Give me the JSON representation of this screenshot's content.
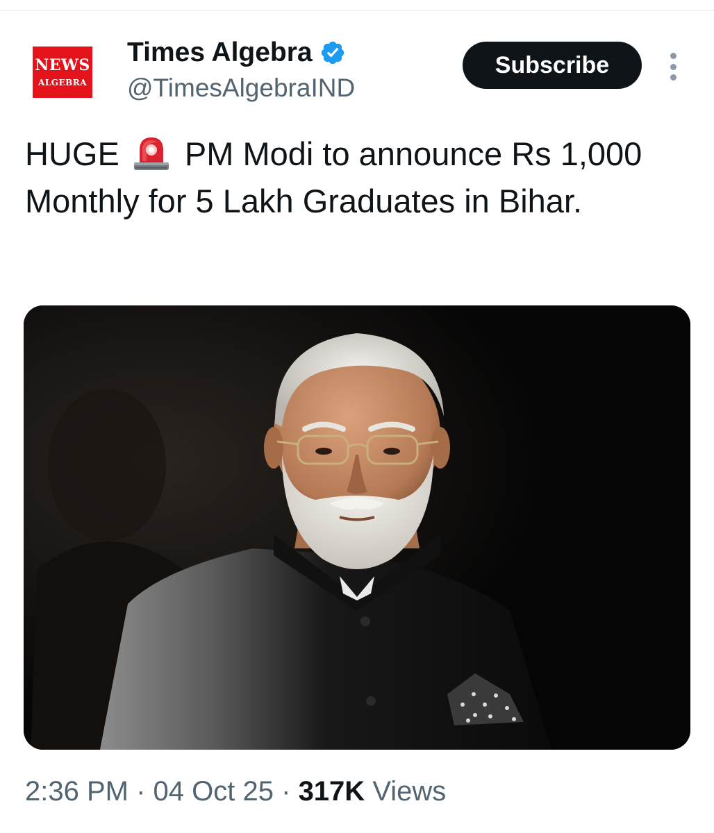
{
  "account": {
    "logo_line1": "NEWS",
    "logo_line2": "ALGEBRA",
    "display_name": "Times Algebra",
    "handle": "@TimesAlgebraIND",
    "verified": true
  },
  "actions": {
    "subscribe_label": "Subscribe"
  },
  "tweet": {
    "text_before_icon": "HUGE",
    "icon": "police-car-light-siren",
    "text_after_icon": "PM Modi to announce Rs 1,000 Monthly for 5 Lakh Graduates in Bihar."
  },
  "media": {
    "type": "photo",
    "description_icon": "portrait-photo"
  },
  "meta": {
    "time": "2:36 PM",
    "date": "04 Oct 25",
    "views_count": "317K",
    "views_label": "Views",
    "separator": "·"
  },
  "colors": {
    "text": "#0f1419",
    "secondary": "#536471",
    "button_bg": "#0f1419",
    "verified": "#1d9bf0",
    "logo_red": "#e3121b"
  }
}
